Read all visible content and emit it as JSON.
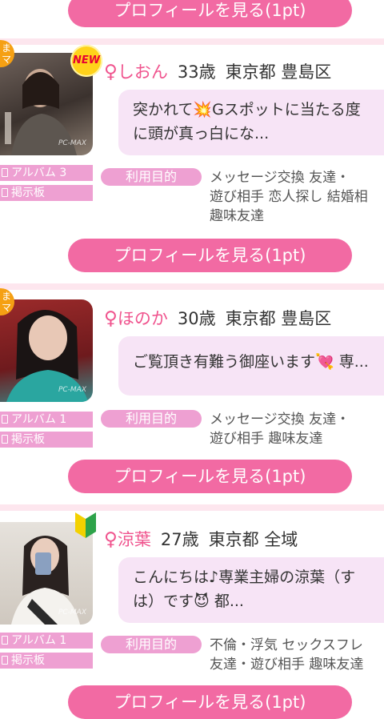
{
  "button_label": "プロフィールを見る(1pt)",
  "labels": {
    "album": "アルバム",
    "board": "掲示板",
    "purpose": "利用目的",
    "mama_line1": "ま",
    "mama_line2": "マ",
    "new_badge": "NEW",
    "watermark": "PC-MAX"
  },
  "profiles": [
    {
      "name": "しおん",
      "age": "33歳",
      "location": "東京都 豊島区",
      "message_line1": "突かれて💥Gスポットに当たる度",
      "message_line2": "に頭が真っ白にな...",
      "album_count": "3",
      "purposes_line1": "メッセージ交換 友達・",
      "purposes_line2": "遊び相手 恋人探し 結婚相",
      "purposes_line3": "趣味友達"
    },
    {
      "name": "ほのか",
      "age": "30歳",
      "location": "東京都 豊島区",
      "message_line1": "ご覧頂き有難う御座います💘 専...",
      "album_count": "1",
      "purposes_line1": "メッセージ交換 友達・",
      "purposes_line2": "遊び相手 趣味友達"
    },
    {
      "name": "涼葉",
      "age": "27歳",
      "location": "東京都 全域",
      "message_line1": "こんにちは♪専業主婦の涼葉（す",
      "message_line2": "は）です😈 都...",
      "album_count": "1",
      "purposes_line1": "不倫・浮気 セックスフレ",
      "purposes_line2": "友達・遊び相手 趣味友達"
    }
  ],
  "colors": {
    "pink": "#f26aa3",
    "tag": "#eea0d2",
    "bubble": "#f7e4f6",
    "name": "#f0548e"
  }
}
